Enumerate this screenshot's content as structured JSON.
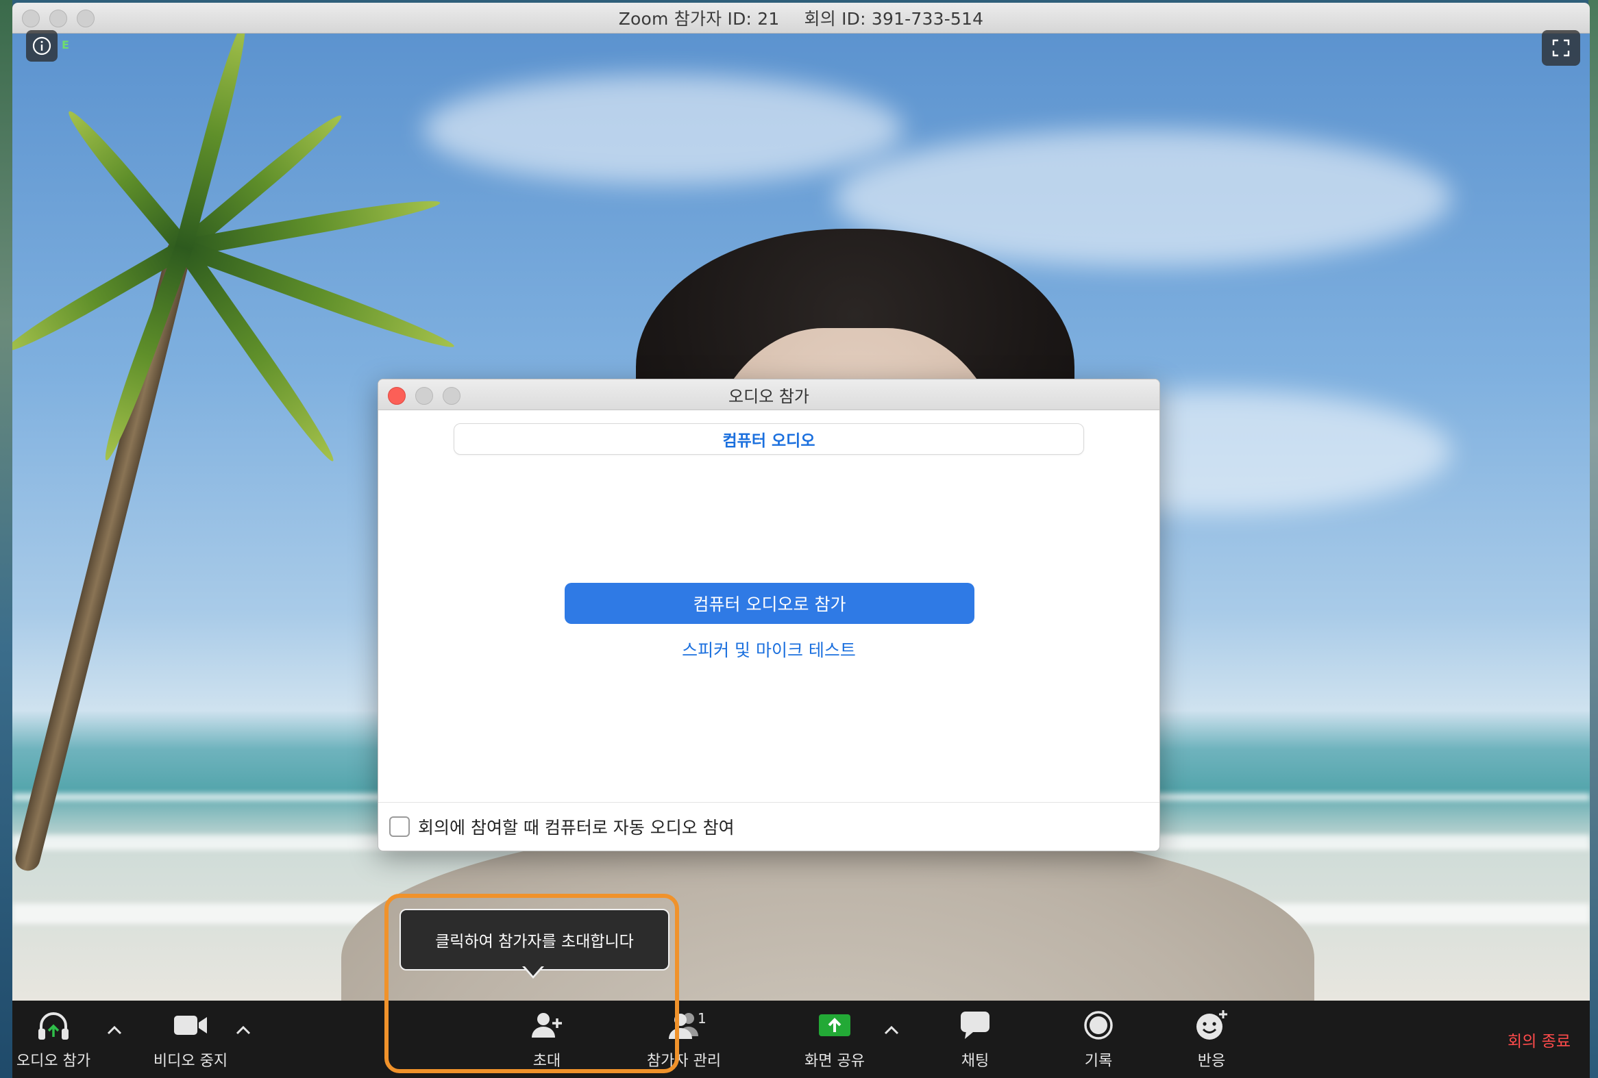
{
  "window": {
    "title_participant": "Zoom 참가자 ID: 21",
    "title_meeting": "회의 ID: 391-733-514",
    "encryption_badge": "E"
  },
  "dialog": {
    "title": "오디오 참가",
    "tab_label": "컴퓨터 오디오",
    "join_button": "컴퓨터 오디오로 참가",
    "test_link": "스피커 및 마이크 테스트",
    "auto_join_checkbox_label": "회의에 참여할 때 컴퓨터로 자동 오디오 참여",
    "auto_join_checked": false
  },
  "tooltip": {
    "text": "클릭하여 참가자를 초대합니다"
  },
  "toolbar": {
    "audio_label": "오디오 참가",
    "video_label": "비디오 중지",
    "invite_label": "초대",
    "participants_label": "참가자 관리",
    "participants_count": "1",
    "share_label": "화면 공유",
    "chat_label": "채팅",
    "record_label": "기록",
    "reactions_label": "반응",
    "end_label": "회의 종료"
  },
  "colors": {
    "accent_blue": "#2f7ae5",
    "link_blue": "#1a6fde",
    "share_green": "#23a936",
    "end_red": "#ff4b4b",
    "highlight_orange": "#f0922b",
    "toolbar_bg": "#1a1a1a"
  },
  "icons": [
    "info-icon",
    "fullscreen-icon",
    "headphones-icon",
    "video-camera-icon",
    "caret-up-icon",
    "add-person-icon",
    "participants-icon",
    "share-screen-icon",
    "chat-bubble-icon",
    "record-icon",
    "reaction-smiley-icon"
  ]
}
